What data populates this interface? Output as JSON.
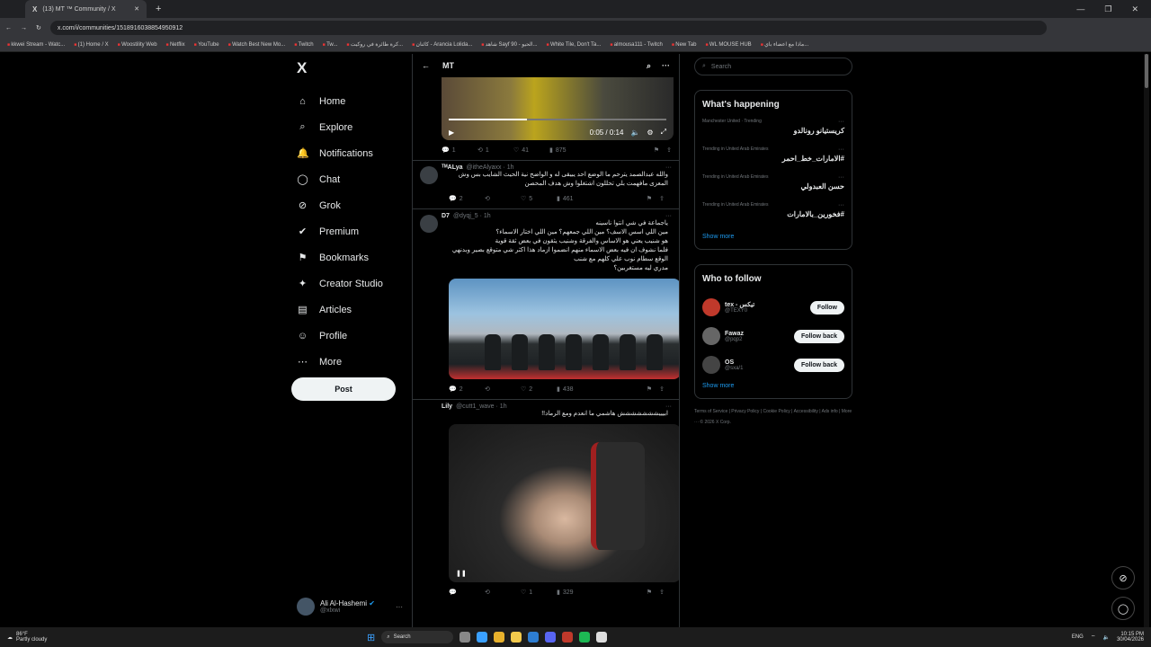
{
  "browser": {
    "tab_title": "(13) MT ™ Community / X",
    "url": "x.com/i/communities/1518916038854950912",
    "bookmarks": [
      "kkwei Stream - Watc...",
      "(1) Home / X",
      "Woostility Web",
      "Netflix",
      "YouTube",
      "Watch Best New Mo...",
      "Twitch",
      "Tw...",
      "کرة طائرة في روكيت...",
      "كائنان - Arancia Lolida...",
      "شاهد Sayf 90 - الحيو...",
      "White Tile, Don't Ta...",
      "almousa111 - Twitch",
      "New Tab",
      "WL MOUSE HUB",
      "ماذا مع اعضاء باي..."
    ]
  },
  "nav": {
    "logo": "X",
    "items": [
      {
        "icon": "⌂",
        "label": "Home"
      },
      {
        "icon": "⌕",
        "label": "Explore"
      },
      {
        "icon": "🔔",
        "label": "Notifications"
      },
      {
        "icon": "◯",
        "label": "Chat"
      },
      {
        "icon": "⊘",
        "label": "Grok"
      },
      {
        "icon": "✔",
        "label": "Premium"
      },
      {
        "icon": "⚑",
        "label": "Bookmarks"
      },
      {
        "icon": "✦",
        "label": "Creator Studio"
      },
      {
        "icon": "▤",
        "label": "Articles"
      },
      {
        "icon": "☺",
        "label": "Profile"
      },
      {
        "icon": "⋯",
        "label": "More"
      }
    ],
    "post_label": "Post"
  },
  "account": {
    "name": "Ali Al-Hashemi",
    "handle": "@xlxwi",
    "more": "···"
  },
  "feed": {
    "title": "MT",
    "video": {
      "time": "0:05 / 0:14",
      "progress": 0.36
    },
    "post0_actions": {
      "replies": "1",
      "reposts": "1",
      "likes": "41",
      "views": "875"
    },
    "tweets": [
      {
        "name": "ᵀᴹALya",
        "handle": "@itheAlyaxx · 1h",
        "text": "والله عبدالصمد يترحم ما الوضع احد يبيقى له و الواضح نية الحيث الشايب بس وش المعزى مافهمت بلي تحللون اشتغلوا وش هدف المحصن",
        "replies": "2",
        "reposts": "",
        "likes": "5",
        "views": "461"
      },
      {
        "name": "D7",
        "handle": "@dyqj_5 · 1h",
        "text": "ياجماعة في شي انتوا ناسينه\nمين اللي اسس الاسف؟ مين اللي جمعهم؟ مين اللي اختار الاسماء؟\nهو شنيب يعني هو الاساس والفرقة وشنيب يثقون في بعض ثقة قوية\nفلما نشوف ان فيه بعض الاسماء منهم انضموا ازماد هذا اكثر شي متوقع بصير وبدنهي\nالوقع سطام نوب علي كلهم مع شنب\nمدري ليه مستغربين؟",
        "replies": "2",
        "reposts": "",
        "likes": "2",
        "views": "438"
      },
      {
        "name": "Lily",
        "handle": "@cutt1_wave · 1h",
        "text": "ابيييششششششش هاشمي ما انعدم ومع الرماد!!",
        "replies": "",
        "reposts": "",
        "likes": "1",
        "views": "329"
      }
    ]
  },
  "right": {
    "search_placeholder": "Search",
    "happening_title": "What's happening",
    "trends": [
      {
        "meta": "Manchester United · Trending",
        "name": "كريستيانو رونالدو"
      },
      {
        "meta": "Trending in United Arab Emirates",
        "name": "#الامارات_خط_احمر"
      },
      {
        "meta": "Trending in United Arab Emirates",
        "name": "حسن العبدولي"
      },
      {
        "meta": "Trending in United Arab Emirates",
        "name": "#فخورين_بالامارات"
      }
    ],
    "show_more": "Show more",
    "who_title": "Who to follow",
    "follow": [
      {
        "name": "tex - تيكس",
        "handle": "@TEXY0",
        "btn": "Follow",
        "color": "#c0392b"
      },
      {
        "name": "Fawaz",
        "handle": "@pqp2",
        "btn": "Follow back",
        "color": "#666"
      },
      {
        "name": "OS",
        "handle": "@sxa/1",
        "btn": "Follow back",
        "color": "#444"
      }
    ],
    "footer": "Terms of Service | Privacy Policy | Cookie Policy | Accessibility | Ads info | More ··· © 2026 X Corp."
  },
  "taskbar": {
    "temp": "86°F",
    "weather": "Partly cloudy",
    "search": "Search",
    "lang": "ENG",
    "time": "10:15 PM",
    "date": "30/04/2026"
  }
}
